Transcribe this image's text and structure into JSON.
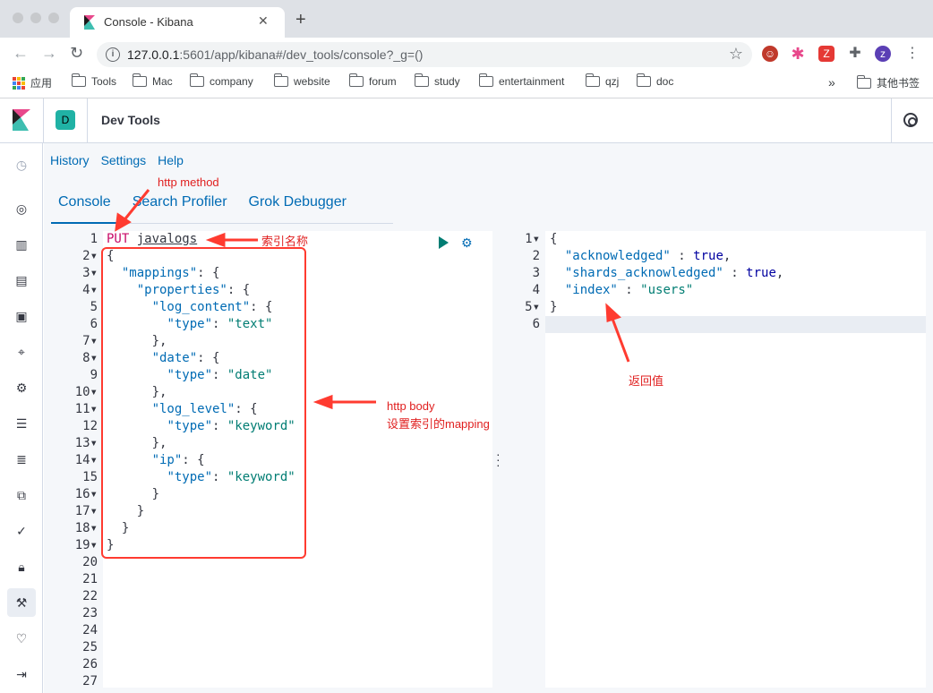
{
  "browser": {
    "tab_title": "Console - Kibana",
    "url_host": "127.0.0.1",
    "url_rest": ":5601/app/kibana#/dev_tools/console?_g=()",
    "avatar_letter": "z",
    "bookmarks": [
      "应用",
      "Tools",
      "Mac",
      "company",
      "website",
      "forum",
      "study",
      "entertainment",
      "qzj",
      "doc"
    ],
    "other_bookmarks": "其他书签",
    "more": "»"
  },
  "kibana": {
    "space_letter": "D",
    "page_title": "Dev Tools",
    "links": [
      "History",
      "Settings",
      "Help"
    ],
    "tabs": [
      "Console",
      "Search Profiler",
      "Grok Debugger"
    ]
  },
  "request": {
    "method": "PUT",
    "index": "javalogs",
    "line_count": 27,
    "lines": [
      [
        [
          "p",
          "{"
        ]
      ],
      [
        [
          "p",
          "  "
        ],
        [
          "k",
          "\"mappings\""
        ],
        [
          "p",
          ": {"
        ]
      ],
      [
        [
          "p",
          "    "
        ],
        [
          "k",
          "\"properties\""
        ],
        [
          "p",
          ": {"
        ]
      ],
      [
        [
          "p",
          "      "
        ],
        [
          "k",
          "\"log_content\""
        ],
        [
          "p",
          ": {"
        ]
      ],
      [
        [
          "p",
          "        "
        ],
        [
          "k",
          "\"type\""
        ],
        [
          "p",
          ": "
        ],
        [
          "s",
          "\"text\""
        ]
      ],
      [
        [
          "p",
          "      },"
        ]
      ],
      [
        [
          "p",
          "      "
        ],
        [
          "k",
          "\"date\""
        ],
        [
          "p",
          ": {"
        ]
      ],
      [
        [
          "p",
          "        "
        ],
        [
          "k",
          "\"type\""
        ],
        [
          "p",
          ": "
        ],
        [
          "s",
          "\"date\""
        ]
      ],
      [
        [
          "p",
          "      },"
        ]
      ],
      [
        [
          "p",
          "      "
        ],
        [
          "k",
          "\"log_level\""
        ],
        [
          "p",
          ": {"
        ]
      ],
      [
        [
          "p",
          "        "
        ],
        [
          "k",
          "\"type\""
        ],
        [
          "p",
          ": "
        ],
        [
          "s",
          "\"keyword\""
        ]
      ],
      [
        [
          "p",
          "      },"
        ]
      ],
      [
        [
          "p",
          "      "
        ],
        [
          "k",
          "\"ip\""
        ],
        [
          "p",
          ": {"
        ]
      ],
      [
        [
          "p",
          "        "
        ],
        [
          "k",
          "\"type\""
        ],
        [
          "p",
          ": "
        ],
        [
          "s",
          "\"keyword\""
        ]
      ],
      [
        [
          "p",
          "      }"
        ]
      ],
      [
        [
          "p",
          "    }"
        ]
      ],
      [
        [
          "p",
          "  }"
        ]
      ],
      [
        [
          "p",
          "}"
        ]
      ]
    ],
    "fold_lines": [
      2,
      3,
      4,
      7,
      8,
      10,
      11,
      13,
      14,
      16,
      17,
      18,
      19
    ]
  },
  "response": {
    "lines": [
      [
        [
          "p",
          "{"
        ]
      ],
      [
        [
          "p",
          "  "
        ],
        [
          "k",
          "\"acknowledged\""
        ],
        [
          "p",
          " : "
        ],
        [
          "b",
          "true"
        ],
        [
          "p",
          ","
        ]
      ],
      [
        [
          "p",
          "  "
        ],
        [
          "k",
          "\"shards_acknowledged\""
        ],
        [
          "p",
          " : "
        ],
        [
          "b",
          "true"
        ],
        [
          "p",
          ","
        ]
      ],
      [
        [
          "p",
          "  "
        ],
        [
          "k",
          "\"index\""
        ],
        [
          "p",
          " : "
        ],
        [
          "s",
          "\"users\""
        ]
      ],
      [
        [
          "p",
          "}"
        ]
      ],
      [
        [
          "p",
          ""
        ]
      ]
    ]
  },
  "annotations": {
    "method": "http method",
    "index_name": "索引名称",
    "body_title": "http body",
    "body_desc": "设置索引的mapping",
    "response": "返回值"
  }
}
